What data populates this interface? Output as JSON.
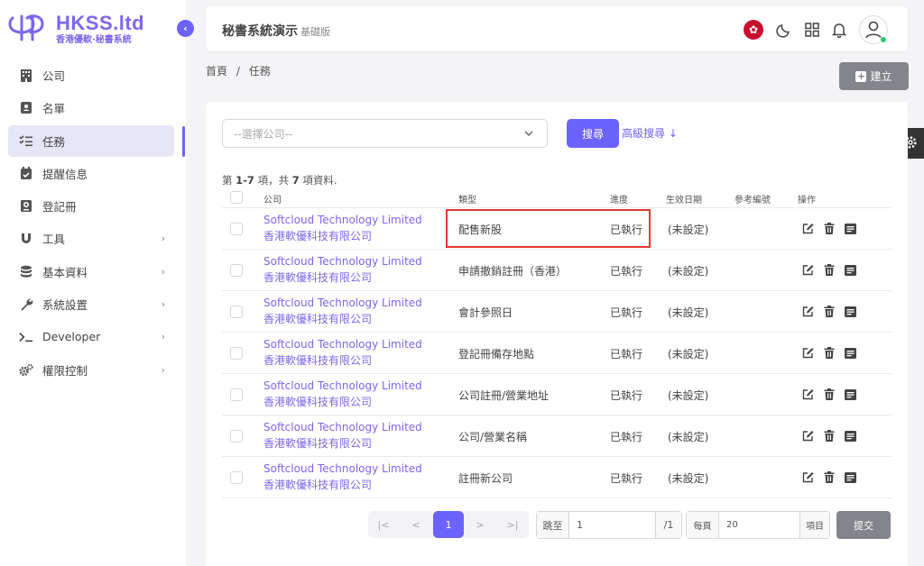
{
  "brand": {
    "title": "HKSS.ltd",
    "subtitle": "香港優軟·秘書系統"
  },
  "sidebar": {
    "items": [
      {
        "label": "公司",
        "icon": "building-icon"
      },
      {
        "label": "名單",
        "icon": "contact-card-icon"
      },
      {
        "label": "任務",
        "icon": "task-list-icon",
        "active": true
      },
      {
        "label": "提醒信息",
        "icon": "calendar-check-icon"
      },
      {
        "label": "登記冊",
        "icon": "register-book-icon"
      },
      {
        "label": "工具",
        "icon": "magnet-icon",
        "has_children": true
      },
      {
        "label": "基本資料",
        "icon": "database-icon",
        "has_children": true
      },
      {
        "label": "系統設置",
        "icon": "wrench-icon",
        "has_children": true
      },
      {
        "label": "Developer",
        "icon": "terminal-icon",
        "has_children": true
      },
      {
        "label": "權限控制",
        "icon": "cogs-icon",
        "has_children": true
      }
    ]
  },
  "header": {
    "title": "秘書系統演示",
    "edition": "基礎版"
  },
  "breadcrumb": {
    "home": "首頁",
    "sep": "/",
    "current": "任務"
  },
  "toolbar": {
    "create_label": "建立"
  },
  "filter": {
    "company_placeholder": "--選擇公司--",
    "search_label": "搜尋",
    "advanced_label": "高級搜尋"
  },
  "records": {
    "prefix": "第 ",
    "range": "1-7",
    "mid": " 項，共 ",
    "total": "7",
    "suffix": " 項資料."
  },
  "table": {
    "columns": {
      "company": "公司",
      "type": "類型",
      "progress": "進度",
      "effective_date": "生效日期",
      "reference": "參考編號",
      "actions": "操作"
    },
    "rows": [
      {
        "company_en": "Softcloud Technology Limited",
        "company_zh": "香港軟優科技有限公司",
        "type": "配售新股",
        "progress": "已執行",
        "effective_date": "(未設定)"
      },
      {
        "company_en": "Softcloud Technology Limited",
        "company_zh": "香港軟優科技有限公司",
        "type": "申請撤銷註冊（香港）",
        "progress": "已執行",
        "effective_date": "(未設定)"
      },
      {
        "company_en": "Softcloud Technology Limited",
        "company_zh": "香港軟優科技有限公司",
        "type": "會計參照日",
        "progress": "已執行",
        "effective_date": "(未設定)"
      },
      {
        "company_en": "Softcloud Technology Limited",
        "company_zh": "香港軟優科技有限公司",
        "type": "登記冊備存地點",
        "progress": "已執行",
        "effective_date": "(未設定)"
      },
      {
        "company_en": "Softcloud Technology Limited",
        "company_zh": "香港軟優科技有限公司",
        "type": "公司註冊/營業地址",
        "progress": "已執行",
        "effective_date": "(未設定)"
      },
      {
        "company_en": "Softcloud Technology Limited",
        "company_zh": "香港軟優科技有限公司",
        "type": "公司/營業名稱",
        "progress": "已執行",
        "effective_date": "(未設定)"
      },
      {
        "company_en": "Softcloud Technology Limited",
        "company_zh": "香港軟優科技有限公司",
        "type": "註冊新公司",
        "progress": "已執行",
        "effective_date": "(未設定)"
      }
    ]
  },
  "pagination": {
    "first": "|<",
    "prev": "<",
    "current": "1",
    "next": ">",
    "last": ">|",
    "jump_label": "跳至",
    "jump_value": "1",
    "total_pages": "/1",
    "per_page_label": "每頁",
    "per_page_value": "20",
    "per_page_unit": "項目",
    "submit_label": "提交"
  },
  "colors": {
    "accent": "#6c63ff",
    "brand": "#7b68ee",
    "highlight": "#e53935",
    "button_grey": "#82868b"
  }
}
